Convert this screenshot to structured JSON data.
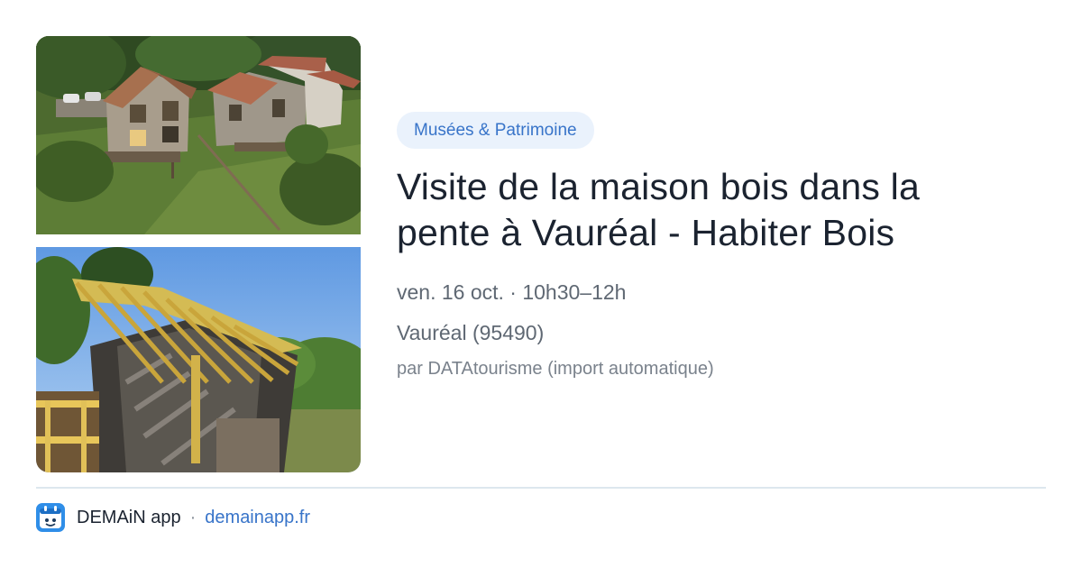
{
  "event": {
    "category": "Musées & Patrimoine",
    "title": "Visite de la maison bois dans la pente à Vauréal - Habiter Bois",
    "date": "ven. 16 oct. · 10h30–12h",
    "location": "Vauréal (95490)",
    "source": "par DATAtourisme (import automatique)"
  },
  "footer": {
    "app_name": "DEMAiN app",
    "separator": "·",
    "link": "demainapp.fr"
  },
  "colors": {
    "accent": "#3874c9",
    "category_bg": "#eaf2fc",
    "title": "#1b2330",
    "muted": "#5f6873"
  },
  "icons": {
    "app_logo": "demain-app-logo-icon"
  }
}
